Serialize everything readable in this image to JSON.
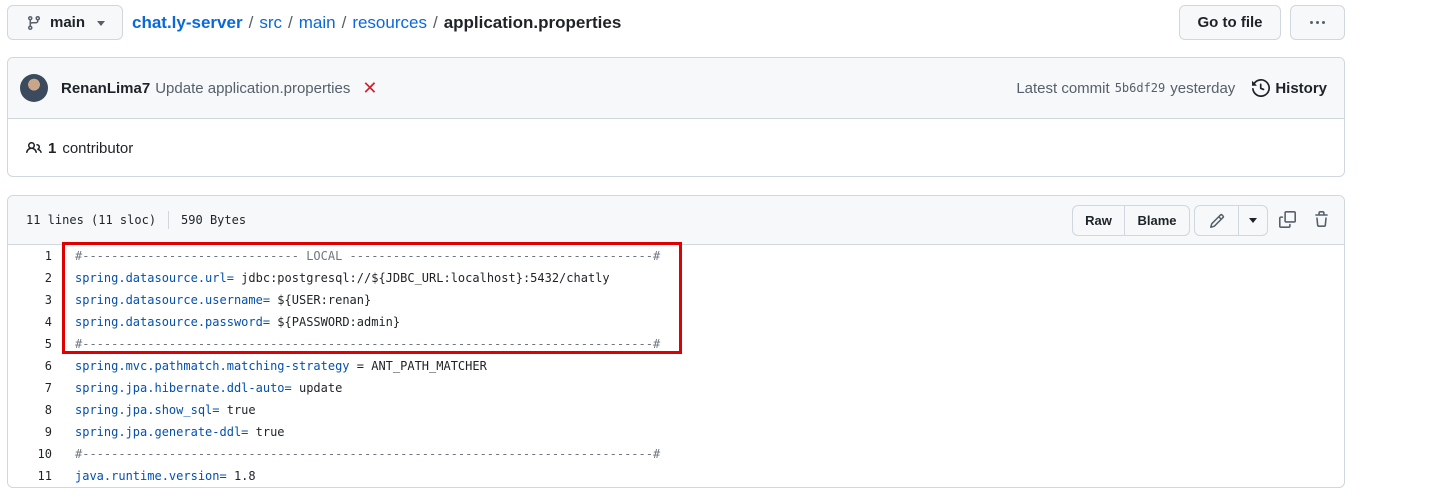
{
  "topbar": {
    "branch": "main",
    "breadcrumb": {
      "repo": "chat.ly-server",
      "parts": [
        "src",
        "main",
        "resources"
      ],
      "current": "application.properties"
    },
    "goto_label": "Go to file"
  },
  "commit": {
    "author": "RenanLima7",
    "message": "Update application.properties",
    "latest_label": "Latest commit",
    "sha": "5b6df29",
    "time": "yesterday",
    "history_label": "History",
    "contributors_count": "1",
    "contributors_label": "contributor"
  },
  "file": {
    "lines_info": "11 lines (11 sloc)",
    "size": "590 Bytes",
    "raw_label": "Raw",
    "blame_label": "Blame"
  },
  "code_lines": [
    {
      "n": "1",
      "key": "",
      "val": "",
      "comment": "#------------------------------ LOCAL ------------------------------------------#"
    },
    {
      "n": "2",
      "key": "spring.datasource.url=",
      "val": " jdbc:postgresql://${JDBC_URL:localhost}:5432/chatly",
      "comment": ""
    },
    {
      "n": "3",
      "key": "spring.datasource.username=",
      "val": " ${USER:renan}",
      "comment": ""
    },
    {
      "n": "4",
      "key": "spring.datasource.password=",
      "val": " ${PASSWORD:admin}",
      "comment": ""
    },
    {
      "n": "5",
      "key": "",
      "val": "",
      "comment": "#-------------------------------------------------------------------------------#"
    },
    {
      "n": "6",
      "key": "spring.mvc.pathmatch.matching-strategy",
      "val": " = ANT_PATH_MATCHER",
      "comment": ""
    },
    {
      "n": "7",
      "key": "spring.jpa.hibernate.ddl-auto=",
      "val": " update",
      "comment": ""
    },
    {
      "n": "8",
      "key": "spring.jpa.show_sql=",
      "val": " true",
      "comment": ""
    },
    {
      "n": "9",
      "key": "spring.jpa.generate-ddl=",
      "val": " true",
      "comment": ""
    },
    {
      "n": "10",
      "key": "",
      "val": "",
      "comment": "#-------------------------------------------------------------------------------#"
    },
    {
      "n": "11",
      "key": "java.runtime.version=",
      "val": " 1.8",
      "comment": ""
    }
  ],
  "colors": {
    "link": "#0969da",
    "annotation_box": "#e00000",
    "cancel_x": "#cf222e"
  },
  "icons": [
    "git-branch-icon",
    "chevron-down-icon",
    "kebab-horizontal-icon",
    "x-icon",
    "history-icon",
    "people-icon",
    "pencil-icon",
    "copy-icon",
    "trash-icon"
  ]
}
